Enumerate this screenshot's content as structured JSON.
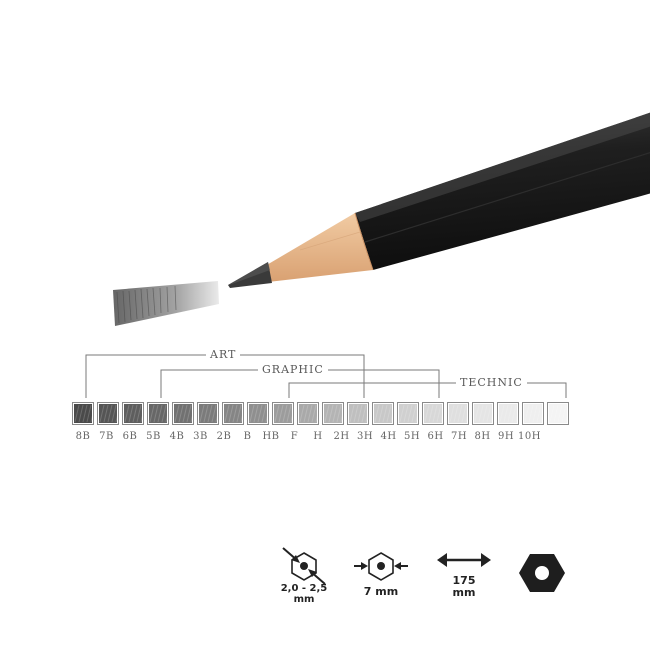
{
  "scale": {
    "groups": [
      {
        "label": "ART",
        "from": 0,
        "to": 11
      },
      {
        "label": "GRAPHIC",
        "from": 3,
        "to": 14
      },
      {
        "label": "TECHNIC",
        "from": 8,
        "to": 19
      }
    ],
    "grades": [
      {
        "label": "8B",
        "shade": "#4a4a4a"
      },
      {
        "label": "7B",
        "shade": "#555555"
      },
      {
        "label": "6B",
        "shade": "#5e5e5e"
      },
      {
        "label": "5B",
        "shade": "#676767"
      },
      {
        "label": "4B",
        "shade": "#717171"
      },
      {
        "label": "3B",
        "shade": "#7b7b7b"
      },
      {
        "label": "2B",
        "shade": "#858585"
      },
      {
        "label": "B",
        "shade": "#8f8f8f"
      },
      {
        "label": "HB",
        "shade": "#9c9c9c"
      },
      {
        "label": "F",
        "shade": "#a9a9a9"
      },
      {
        "label": "H",
        "shade": "#b4b4b4"
      },
      {
        "label": "2H",
        "shade": "#bfbfbf"
      },
      {
        "label": "3H",
        "shade": "#c8c8c8"
      },
      {
        "label": "4H",
        "shade": "#d0d0d0"
      },
      {
        "label": "5H",
        "shade": "#d8d8d8"
      },
      {
        "label": "6H",
        "shade": "#dfdfdf"
      },
      {
        "label": "7H",
        "shade": "#e5e5e5"
      },
      {
        "label": "8H",
        "shade": "#eaeaea"
      },
      {
        "label": "9H",
        "shade": "#efefef"
      },
      {
        "label": "10H",
        "shade": "#f4f4f4"
      }
    ]
  },
  "specs": {
    "lead": {
      "line1": "2,0 - 2,5",
      "line2": "mm",
      "icon": "lead-diameter-icon"
    },
    "body": {
      "line1": "7 mm",
      "icon": "body-diameter-icon"
    },
    "length": {
      "line1": "175",
      "line2": "mm",
      "icon": "length-arrow-icon"
    },
    "shape": {
      "icon": "hexagon-shape-icon"
    }
  },
  "colors": {
    "pencil_body": "#1b1b1b",
    "wood": "#e9b88a",
    "graphite": "#3a3a3a"
  }
}
